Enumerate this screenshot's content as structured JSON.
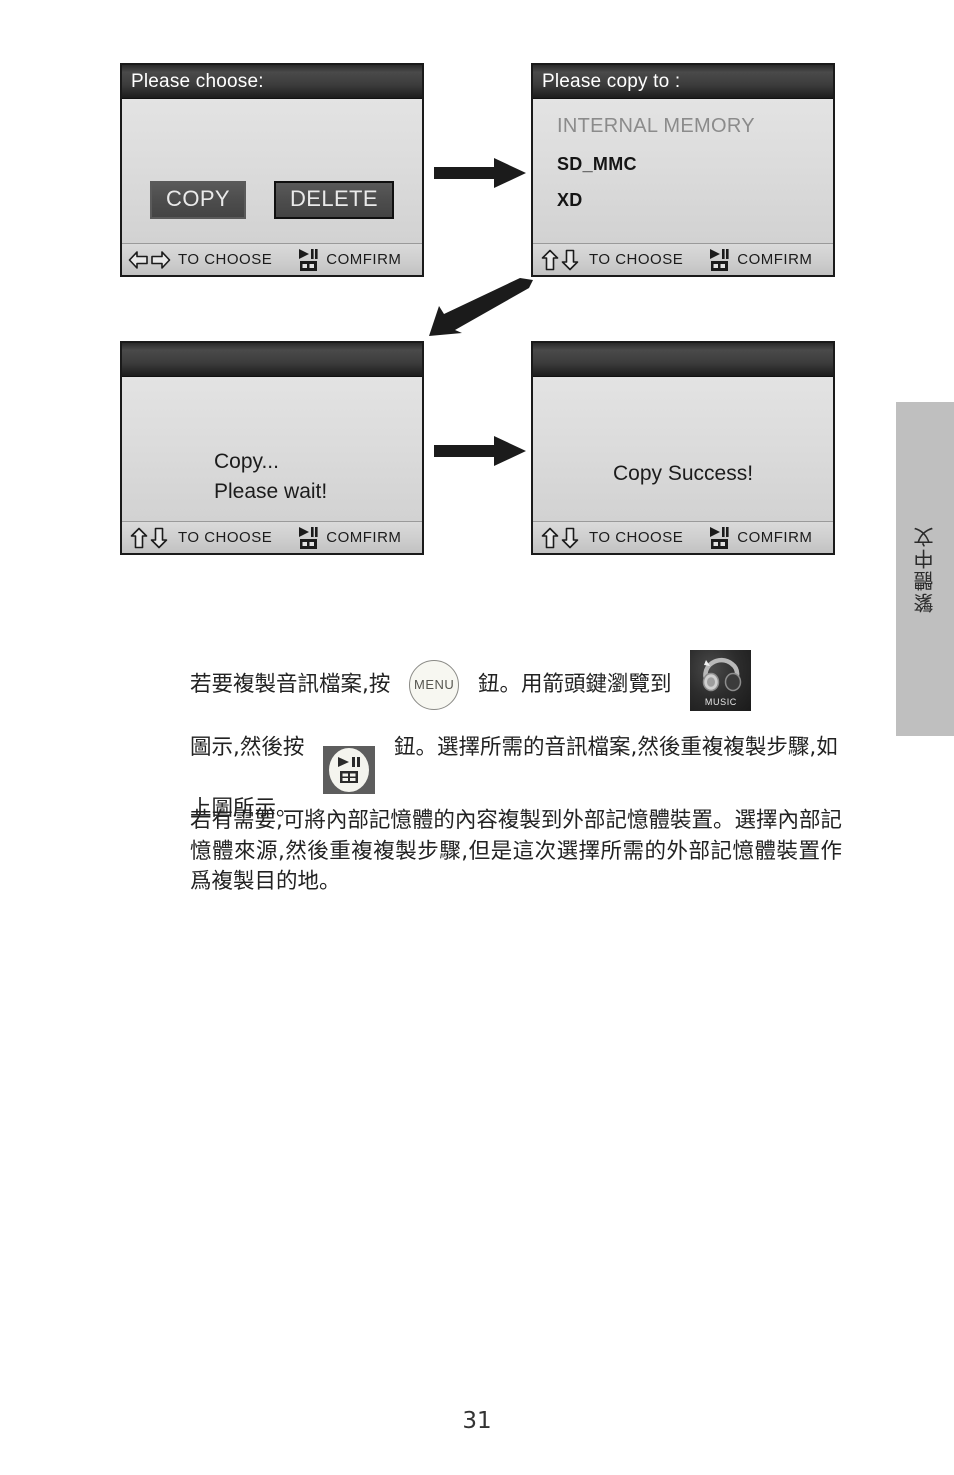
{
  "page": {
    "number": "31",
    "language_tab": "繁體中文"
  },
  "screens": [
    {
      "id": "choose",
      "title": "Please choose:",
      "buttons": [
        {
          "label": "COPY",
          "selected": false
        },
        {
          "label": "DELETE",
          "selected": true
        }
      ],
      "footer": {
        "nav_icon": "left-right-arrows-icon",
        "nav_label": "TO CHOOSE",
        "confirm_icon": "play-pause-menu-icon",
        "confirm_label": "COMFIRM"
      }
    },
    {
      "id": "copy-to",
      "title": "Please copy to :",
      "items": [
        {
          "label": "INTERNAL MEMORY",
          "style": "dim"
        },
        {
          "label": "SD_MMC",
          "style": "strong"
        },
        {
          "label": "XD",
          "style": "strong"
        }
      ],
      "footer": {
        "nav_icon": "up-down-arrows-icon",
        "nav_label": "TO CHOOSE",
        "confirm_icon": "play-pause-menu-icon",
        "confirm_label": "COMFIRM"
      }
    },
    {
      "id": "copying",
      "title": "",
      "message_line1": "Copy...",
      "message_line2": "Please wait!",
      "footer": {
        "nav_icon": "up-down-arrows-icon",
        "nav_label": "TO CHOOSE",
        "confirm_icon": "play-pause-menu-icon",
        "confirm_label": "COMFIRM"
      }
    },
    {
      "id": "success",
      "title": "",
      "message_line1": "Copy Success!",
      "footer": {
        "nav_icon": "up-down-arrows-icon",
        "nav_label": "TO CHOOSE",
        "confirm_icon": "play-pause-menu-icon",
        "confirm_label": "COMFIRM"
      }
    }
  ],
  "body": {
    "para1_seg1": "若要複製音訊檔案,按",
    "menu_button_label": "MENU",
    "para1_seg2": "鈕。用箭頭鍵瀏覽到",
    "music_tile_label": "MUSIC",
    "para1_seg3": "圖示,然後按",
    "para1_seg4": "鈕。選擇所需的音訊檔案,然後重複複製步驟,如上圖所示。",
    "para2": "若有需要,可將內部記憶體的內容複製到外部記憶體裝置。選擇內部記憶體來源,然後重複複製步驟,但是這次選擇所需的外部記憶體裝置作爲複製目的地。"
  },
  "colors": {
    "lcd_background": "#d9d9d9",
    "lcd_titlebar": "#2a2a2a",
    "lcd_button": "#4e4e4e",
    "lang_tab": "#bfbfbf",
    "text": "#222222"
  }
}
